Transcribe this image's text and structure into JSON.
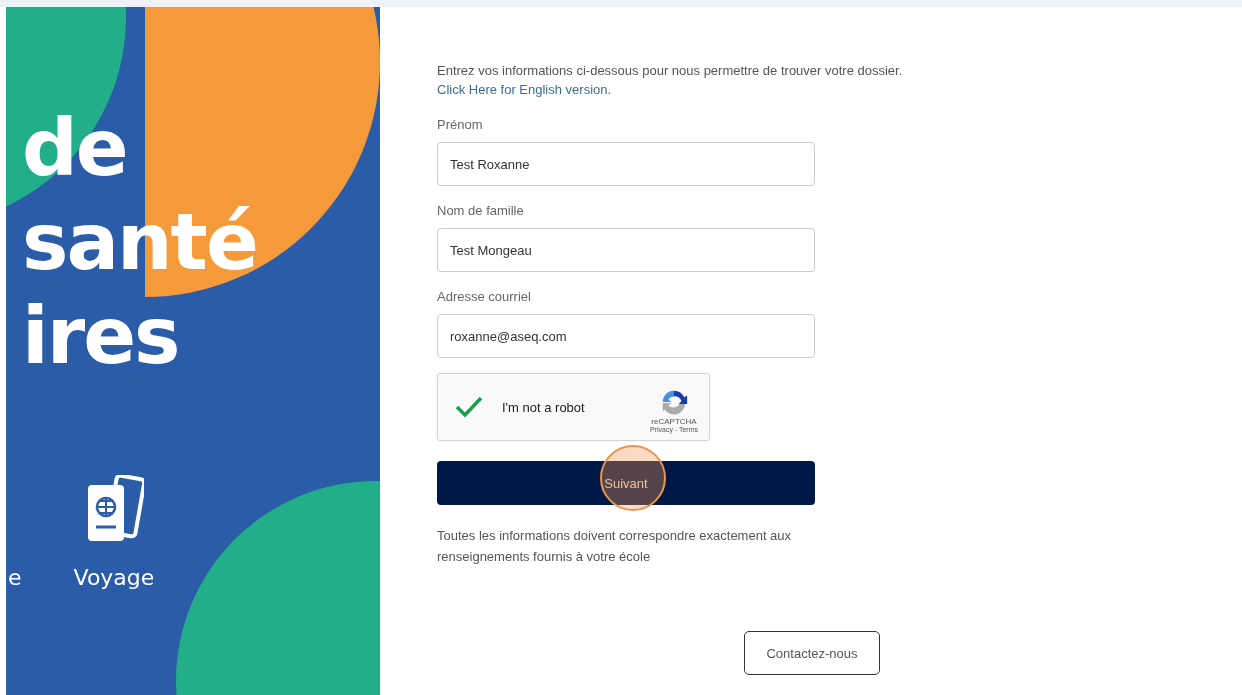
{
  "banner": {
    "headline_lines": [
      "de",
      "santé",
      "ires"
    ],
    "categories": [
      {
        "label": "e",
        "kind": "plain"
      },
      {
        "label": "Voyage",
        "kind": "passport"
      }
    ]
  },
  "form": {
    "intro": "Entrez vos informations ci-dessous pour nous permettre de trouver votre dossier.",
    "language_link": "Click Here for English version.",
    "fields": [
      {
        "label": "Prénom",
        "value": "Test Roxanne"
      },
      {
        "label": "Nom de famille",
        "value": "Test Mongeau"
      },
      {
        "label": "Adresse courriel",
        "value": "roxanne@aseq.com"
      }
    ],
    "captcha": {
      "label": "I'm not a robot",
      "checked": true,
      "brand": "reCAPTCHA",
      "links": "Privacy - Terms"
    },
    "submit": "Suivant",
    "note": "Toutes les informations doivent correspondre exactement aux renseignements fournis à votre école",
    "contact": "Contactez-nous"
  }
}
